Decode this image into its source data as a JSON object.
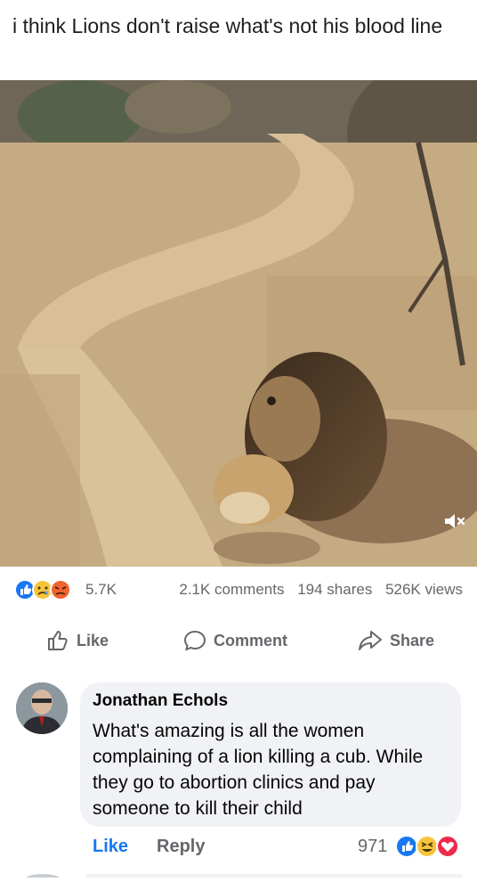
{
  "post": {
    "caption": "i think Lions don't raise what's not his blood line"
  },
  "stats": {
    "reactions": "5.7K",
    "comments": "2.1K comments",
    "shares": "194 shares",
    "views": "526K views"
  },
  "actions": {
    "like": "Like",
    "comment": "Comment",
    "share": "Share"
  },
  "comment": {
    "author": "Jonathan Echols",
    "text": "What's amazing is all the women complaining of a lion killing a cub. While they go to abortion clinics and pay someone to kill their child",
    "like": "Like",
    "reply": "Reply",
    "reaction_count": "971"
  },
  "colors": {
    "accent": "#1877f2",
    "muted": "#65676b",
    "bubble": "#f0f2f5"
  }
}
